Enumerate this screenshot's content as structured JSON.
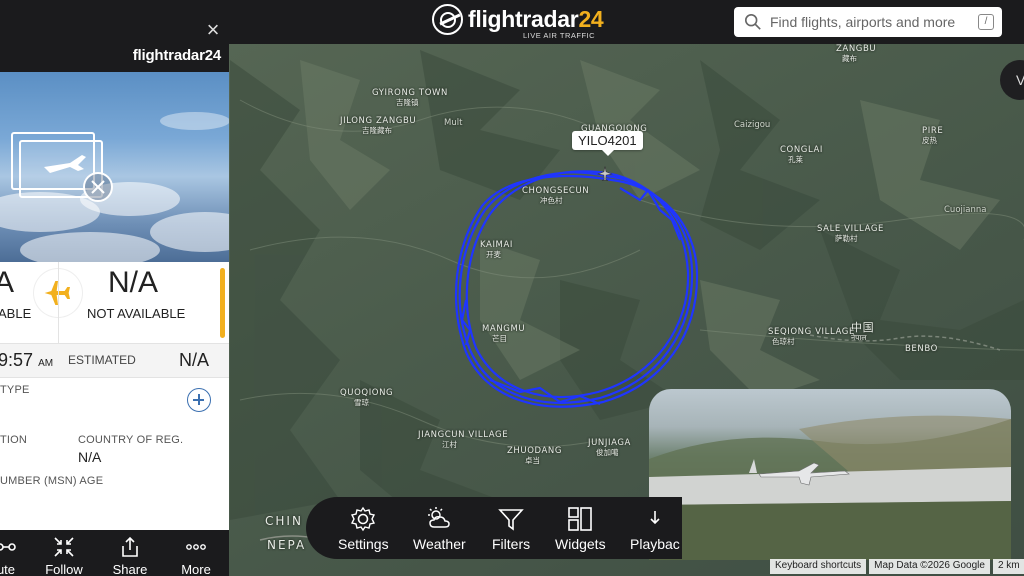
{
  "header": {
    "brand": "flightradar",
    "brand_num": "24",
    "tagline": "LIVE AIR TRAFFIC",
    "search_placeholder": "Find flights, airports and more",
    "search_shortcut": "/"
  },
  "right_edge": {
    "label": "V"
  },
  "map": {
    "places": [
      {
        "name": "GYIRONG TOWN",
        "cn": "吉隆镇"
      },
      {
        "name": "JILONG ZANGBU",
        "cn": "吉隆藏布"
      },
      {
        "name": "Mult"
      },
      {
        "name": "GUANGQIONG",
        "cn": "光琼"
      },
      {
        "name": "ZANGBU",
        "cn": "藏布"
      },
      {
        "name": "Caizigou"
      },
      {
        "name": "PIRE",
        "cn": "皮热"
      },
      {
        "name": "CONGLAI",
        "cn": "孔莱"
      },
      {
        "name": "CHONGSECUN",
        "cn": "冲色村"
      },
      {
        "name": "KAIMAI",
        "cn": "开麦"
      },
      {
        "name": "SALE VILLAGE",
        "cn": "萨勒村"
      },
      {
        "name": "Cuojianna"
      },
      {
        "name": "MANGMU",
        "cn": "芒目"
      },
      {
        "name": "SEQIONG VILLAGE",
        "cn": "色琼村"
      },
      {
        "name": "中国",
        "cn": "नेपाल"
      },
      {
        "name": "BENBO",
        "cn": "本波"
      },
      {
        "name": "QUOQIONG",
        "cn": "雪琼"
      },
      {
        "name": "JIANGCUN VILLAGE",
        "cn": "江村"
      },
      {
        "name": "ZHUODANG",
        "cn": "卓当"
      },
      {
        "name": "JUNJIAGA",
        "cn": "俊加噶"
      },
      {
        "name": "CHIN"
      },
      {
        "name": "NEPA"
      }
    ],
    "callsign": "YILO4201"
  },
  "panel": {
    "brand": "flightradar24",
    "close": "×",
    "left_time": "A",
    "left_label": "ABLE",
    "right_time": "N/A",
    "right_label": "NOT AVAILABLE",
    "time_left": "9:57",
    "time_left_ampm": "AM",
    "time_label": "ESTIMATED",
    "time_value": "N/A",
    "type_label": "TYPE",
    "reg_label": "TION",
    "country_label": "COUNTRY OF REG.",
    "country_value": "N/A",
    "msn_label": "UMBER (MSN) AGE",
    "actions": [
      {
        "label": "ute",
        "icon": "route-icon"
      },
      {
        "label": "Follow",
        "icon": "follow-icon"
      },
      {
        "label": "Share",
        "icon": "share-icon"
      },
      {
        "label": "More",
        "icon": "more-icon"
      }
    ]
  },
  "toolbar": [
    {
      "label": "Settings",
      "icon": "gear-icon"
    },
    {
      "label": "Weather",
      "icon": "weather-icon"
    },
    {
      "label": "Filters",
      "icon": "filter-icon"
    },
    {
      "label": "Widgets",
      "icon": "widgets-icon"
    },
    {
      "label": "Playbac",
      "icon": "playback-icon"
    }
  ],
  "attribution": {
    "shortcuts": "Keyboard shortcuts",
    "map_data": "Map Data ©2026 Google",
    "scale": "2 km"
  },
  "colors": {
    "track": "#1f35ff",
    "accent": "#f2b01e",
    "panel_dark": "#1b1b1d"
  }
}
